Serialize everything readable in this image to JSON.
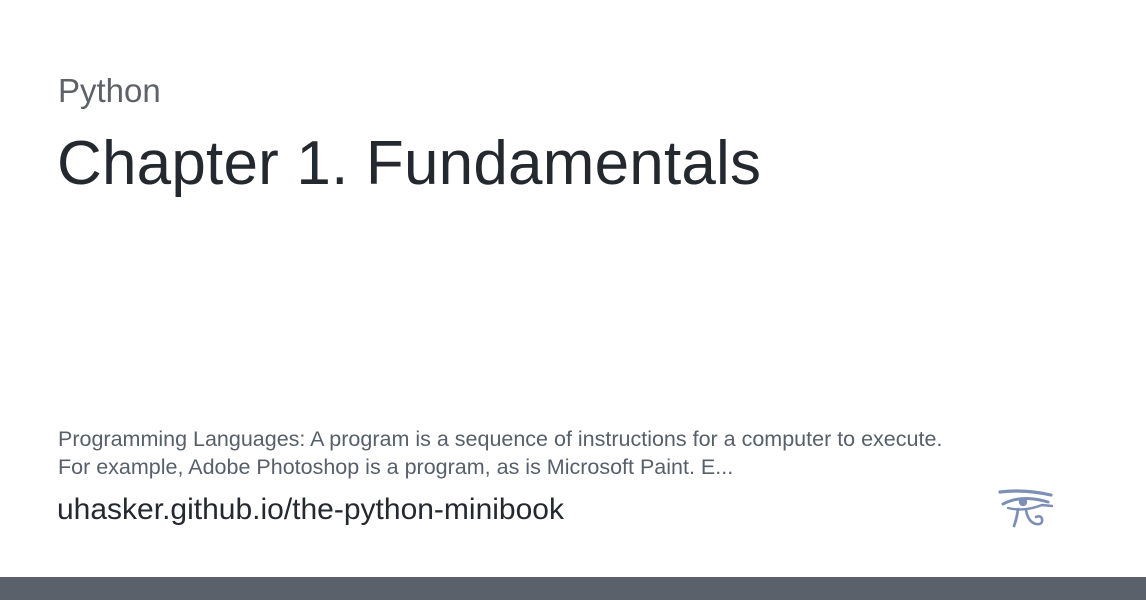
{
  "card": {
    "category": "Python",
    "title": "Chapter 1. Fundamentals",
    "description_lines": [
      "Programming Languages: A program is a sequence of instructions for a computer to execute.",
      "For example, Adobe Photoshop is a program, as is Microsoft Paint. E..."
    ],
    "site_url": "uhasker.github.io/the-python-minibook",
    "logo_icon": "eye-of-horus-icon"
  },
  "colors": {
    "background": "#ffffff",
    "title_text": "#24292f",
    "category_text": "#5f6368",
    "description_text": "#57606a",
    "logo_stroke": "#7d8fb4",
    "bottom_bar": "#5b616b"
  }
}
